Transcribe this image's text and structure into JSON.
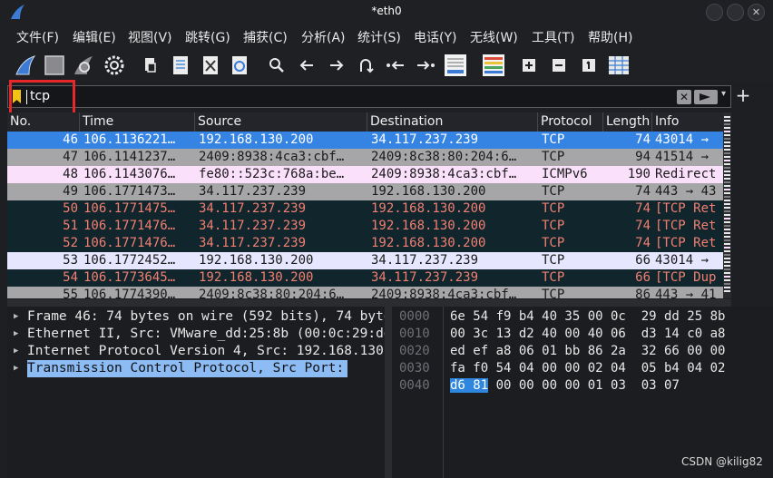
{
  "window": {
    "title": "*eth0",
    "controls": [
      "minimize",
      "maximize",
      "close"
    ]
  },
  "menu": [
    {
      "label": "文件(F)"
    },
    {
      "label": "编辑(E)"
    },
    {
      "label": "视图(V)"
    },
    {
      "label": "跳转(G)"
    },
    {
      "label": "捕获(C)"
    },
    {
      "label": "分析(A)"
    },
    {
      "label": "统计(S)"
    },
    {
      "label": "电话(Y)"
    },
    {
      "label": "无线(W)"
    },
    {
      "label": "工具(T)"
    },
    {
      "label": "帮助(H)"
    }
  ],
  "toolbar": {
    "icons": [
      "shark-fin-start-icon",
      "stop-icon",
      "restart-icon",
      "options-gear-icon",
      "open-file-icon",
      "save-file-icon",
      "close-file-icon",
      "reload-icon",
      "search-icon",
      "go-back-icon",
      "go-forward-icon",
      "go-to-packet-icon",
      "first-packet-icon",
      "last-packet-icon",
      "auto-scroll-icon",
      "colorize-icon",
      "zoom-in-icon",
      "zoom-out-icon",
      "normal-size-icon",
      "resize-columns-icon"
    ]
  },
  "filter": {
    "value": "tcp",
    "clear_label": "✕",
    "dropdown_glyph": "▾",
    "add_label": "+"
  },
  "packet_list": {
    "columns": [
      "No.",
      "Time",
      "Source",
      "Destination",
      "Protocol",
      "Length",
      "Info"
    ],
    "rows": [
      {
        "no": "46",
        "time": "106.1136221…",
        "src": "192.168.130.200",
        "dst": "34.117.237.239",
        "proto": "TCP",
        "len": "74",
        "info": "43014 →",
        "style": "selected"
      },
      {
        "no": "47",
        "time": "106.1141237…",
        "src": "2409:8938:4ca3:cbf…",
        "dst": "2409:8c38:80:204:6…",
        "proto": "TCP",
        "len": "94",
        "info": "41514 →",
        "style": "tcp"
      },
      {
        "no": "48",
        "time": "106.1143076…",
        "src": "fe80::523c:768a:be…",
        "dst": "2409:8938:4ca3:cbf…",
        "proto": "ICMPv6",
        "len": "190",
        "info": "Redirect",
        "style": "icmp"
      },
      {
        "no": "49",
        "time": "106.1771473…",
        "src": "34.117.237.239",
        "dst": "192.168.130.200",
        "proto": "TCP",
        "len": "74",
        "info": "443 → 43",
        "style": "tcp"
      },
      {
        "no": "50",
        "time": "106.1771475…",
        "src": "34.117.237.239",
        "dst": "192.168.130.200",
        "proto": "TCP",
        "len": "74",
        "info": "[TCP Ret",
        "style": "bad"
      },
      {
        "no": "51",
        "time": "106.1771476…",
        "src": "34.117.237.239",
        "dst": "192.168.130.200",
        "proto": "TCP",
        "len": "74",
        "info": "[TCP Ret",
        "style": "bad"
      },
      {
        "no": "52",
        "time": "106.1771476…",
        "src": "34.117.237.239",
        "dst": "192.168.130.200",
        "proto": "TCP",
        "len": "74",
        "info": "[TCP Ret",
        "style": "bad"
      },
      {
        "no": "53",
        "time": "106.1772452…",
        "src": "192.168.130.200",
        "dst": "34.117.237.239",
        "proto": "TCP",
        "len": "66",
        "info": "43014 →",
        "style": "light"
      },
      {
        "no": "54",
        "time": "106.1773645…",
        "src": "192.168.130.200",
        "dst": "34.117.237.239",
        "proto": "TCP",
        "len": "66",
        "info": "[TCP Dup",
        "style": "bad"
      },
      {
        "no": "55",
        "time": "106.1774390…",
        "src": "2409:8c38:80:204:6…",
        "dst": "2409:8938:4ca3:cbf…",
        "proto": "TCP",
        "len": "86",
        "info": "443 → 41",
        "style": "tcp"
      }
    ]
  },
  "details": [
    {
      "text": "Frame 46: 74 bytes on wire (592 bits), 74 bytes captured",
      "selected": false
    },
    {
      "text": "Ethernet II, Src: VMware_dd:25:8b (00:0c:29:dd:25:8b)",
      "selected": false
    },
    {
      "text": "Internet Protocol Version 4, Src: 192.168.130.200",
      "selected": false
    },
    {
      "text": "Transmission Control Protocol, Src Port:",
      "selected": true
    }
  ],
  "bytes": [
    {
      "offset": "0000",
      "pre": "",
      "hl": "",
      "post": "6e 54 f9 b4 40 35 00 0c  29 dd 25 8b"
    },
    {
      "offset": "0010",
      "pre": "",
      "hl": "",
      "post": "00 3c 13 d2 40 00 40 06  d3 14 c0 a8"
    },
    {
      "offset": "0020",
      "pre": "",
      "hl": "",
      "post": "ed ef a8 06 01 bb 86 2a  32 66 00 00"
    },
    {
      "offset": "0030",
      "pre": "",
      "hl": "",
      "post": "fa f0 54 04 00 00 02 04  05 b4 04 02"
    },
    {
      "offset": "0040",
      "pre": "",
      "hl": "d6 81",
      "post": " 00 00 00 00 01 03  03 07"
    }
  ],
  "row_styles": {
    "selected": {
      "bg": "#3584e4",
      "fg": "#ffffff"
    },
    "tcp": {
      "bg": "#a6a6a8",
      "fg": "#1a1a1a"
    },
    "icmp": {
      "bg": "#fbe0fb",
      "fg": "#1a1a1a"
    },
    "bad": {
      "bg": "#10262c",
      "fg": "#f27f72"
    },
    "light": {
      "bg": "#e7e6ff",
      "fg": "#1a1a1a"
    }
  },
  "watermark": "CSDN @kilig82"
}
